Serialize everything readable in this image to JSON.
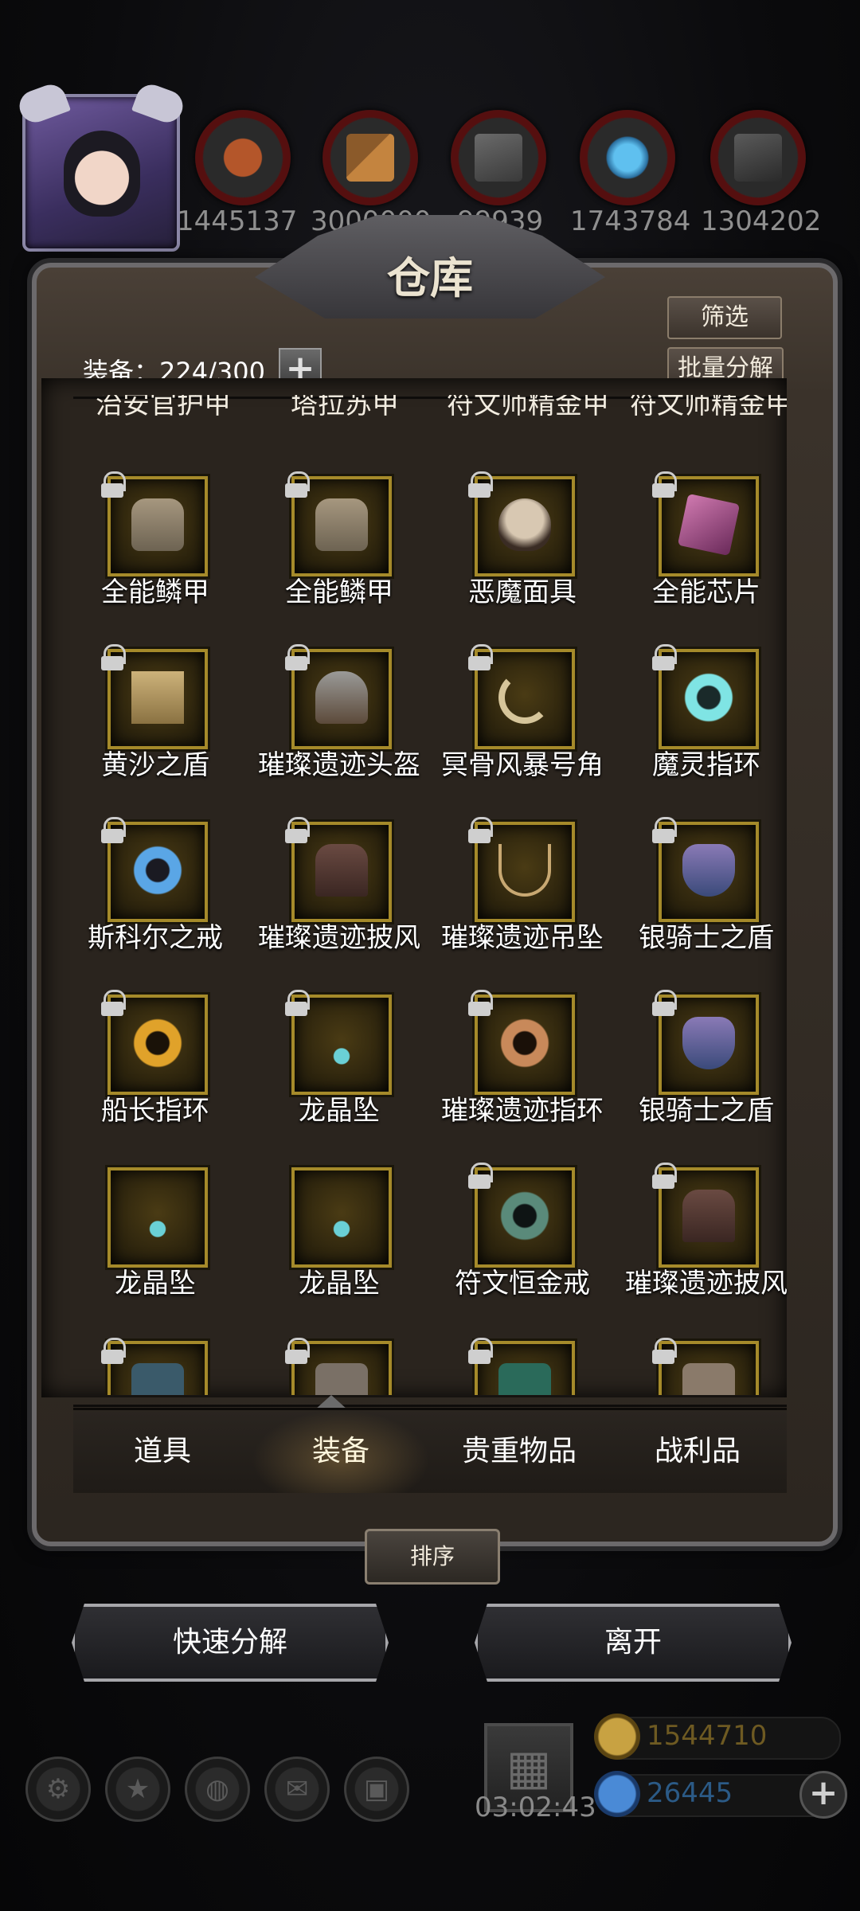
{
  "top": {
    "resources": [
      {
        "icon": "meat-icon",
        "value": "1445137"
      },
      {
        "icon": "wood-icon",
        "value": "3000000"
      },
      {
        "icon": "stone-icon",
        "value": "99939"
      },
      {
        "icon": "crystal-icon",
        "value": "1743784"
      },
      {
        "icon": "iron-icon",
        "value": "1304202"
      }
    ]
  },
  "panel": {
    "title": "仓库",
    "filter_label": "筛选",
    "batch_dismantle_label": "批量分解",
    "count_label": "装备：224/300",
    "plus_label": "+",
    "clipped_row": [
      "治安官护甲",
      "塔拉苏甲",
      "符文师精金甲",
      "符文师精金甲"
    ],
    "items": [
      [
        "全能鳞甲",
        "全能鳞甲",
        "恶魔面具",
        "全能芯片"
      ],
      [
        "黄沙之盾",
        "璀璨遗迹头盔",
        "冥骨风暴号角",
        "魔灵指环"
      ],
      [
        "斯科尔之戒",
        "璀璨遗迹披风",
        "璀璨遗迹吊坠",
        "银骑士之盾"
      ],
      [
        "船长指环",
        "龙晶坠",
        "璀璨遗迹指环",
        "银骑士之盾"
      ],
      [
        "龙晶坠",
        "龙晶坠",
        "符文恒金戒",
        "璀璨遗迹披风"
      ]
    ],
    "tabs": [
      "道具",
      "装备",
      "贵重物品",
      "战利品"
    ],
    "active_tab": "装备",
    "sort_label": "排序",
    "quick_dismantle_label": "快速分解",
    "leave_label": "离开"
  },
  "bottom": {
    "timer": "03:02:43",
    "gold": "1544710",
    "gems": "26445",
    "add_label": "+"
  },
  "colors": {
    "slot_border": "#a58a2a",
    "gold_text": "#6e5a22",
    "gem_text": "#2b5a86"
  }
}
